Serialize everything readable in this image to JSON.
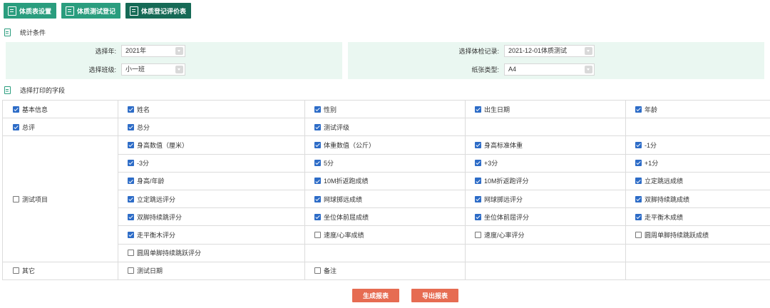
{
  "toolbar": {
    "tabs": [
      {
        "label": "体质表设置",
        "icon": "clipboard-icon"
      },
      {
        "label": "体质测试登记",
        "icon": "document-icon"
      },
      {
        "label": "体质登记评价表",
        "icon": "report-icon"
      }
    ]
  },
  "conditions": {
    "title": "统计条件",
    "year_label": "选择年:",
    "year_value": "2021年",
    "record_label": "选择体检记录:",
    "record_value": "2021-12-01体质测试",
    "class_label": "选择班级:",
    "class_value": "小一班",
    "paper_label": "纸张类型:",
    "paper_value": "A4"
  },
  "print_fields": {
    "title": "选择打印的字段",
    "basic": {
      "label": "基本信息",
      "items": [
        "姓名",
        "性别",
        "出生日期",
        "年龄"
      ]
    },
    "overall": {
      "label": "总评",
      "items": [
        "总分",
        "测试评级"
      ]
    },
    "tests": {
      "label": "测试项目",
      "rows": [
        [
          "身高数值（厘米）",
          "体重数值（公斤）",
          "身高标准体重",
          "-1分"
        ],
        [
          "-3分",
          "5分",
          "+3分",
          "+1分"
        ],
        [
          "身高/年龄",
          "10M折返跑成绩",
          "10M折返跑评分",
          "立定跳远成绩"
        ],
        [
          "立定跳远评分",
          "网球掷远成绩",
          "网球掷远评分",
          "双脚持续跳成绩"
        ],
        [
          "双脚持续跳评分",
          "坐位体前屈成绩",
          "坐位体前屈评分",
          "走平衡木成绩"
        ],
        [
          "走平衡木评分",
          "速度/心率成绩",
          "速度/心率评分",
          "圆周单脚持续跳跃成绩"
        ],
        [
          "圆周单脚持续跳跃评分"
        ]
      ]
    },
    "other": {
      "label": "其它",
      "items": [
        "测试日期",
        "备注"
      ]
    }
  },
  "actions": {
    "generate_label": "生成报表",
    "export_label": "导出报表"
  },
  "colors": {
    "tab_green": "#2a9d7e",
    "tab_active": "#166a56",
    "condition_bg": "#eaf7f1",
    "checkbox_blue": "#2d6cc7",
    "action_orange": "#e66c52"
  }
}
